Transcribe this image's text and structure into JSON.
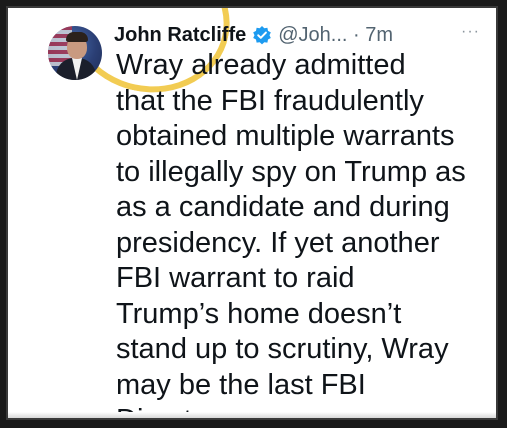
{
  "tweet": {
    "author_name": "John Ratcliffe",
    "handle_and_time": "@Joh... · 7m",
    "more_label": "···",
    "lines": [
      "Wray already admitted",
      "that the FBI fraudulently",
      "obtained multiple warrants",
      "to illegally spy on Trump as",
      "as a candidate and during",
      "presidency. If yet another",
      "FBI warrant to raid",
      "Trump’s home doesn’t",
      "stand up to scrutiny, Wray",
      "may be the last FBI",
      "Director"
    ]
  },
  "icons": {
    "verified": "verified-badge-icon",
    "more": "more-options-icon"
  },
  "colors": {
    "verified_badge": "#1d9bf0",
    "highlight_circle": "#f0c436",
    "text_primary": "#0f1419",
    "text_secondary": "#536471"
  }
}
